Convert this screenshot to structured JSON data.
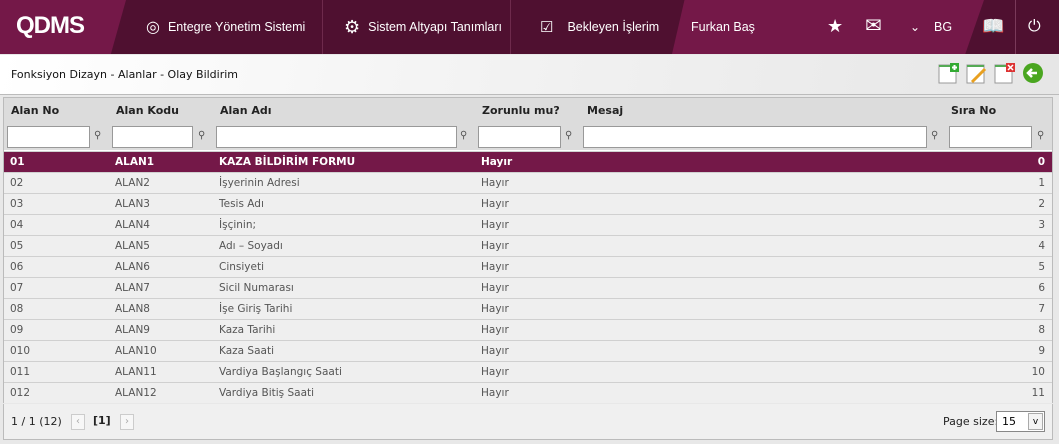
{
  "header": {
    "logo": "QDMS",
    "nav": [
      {
        "label": "Entegre Yönetim Sistemi",
        "icon": "q-logo-icon"
      },
      {
        "label": "Sistem Altyapı Tanımları",
        "icon": "gear-icon"
      },
      {
        "label": "Bekleyen İşlerim",
        "icon": "checklist-icon"
      }
    ],
    "user": "Furkan Baş",
    "lang": "BG"
  },
  "page": {
    "title": "Fonksiyon Dizayn - Alanlar - Olay Bildirim"
  },
  "toolbar": [
    "add-record-icon",
    "edit-record-icon",
    "delete-record-icon",
    "back-icon"
  ],
  "columns": [
    "Alan No",
    "Alan Kodu",
    "Alan Adı",
    "Zorunlu mu?",
    "Mesaj",
    "Sıra No"
  ],
  "rows": [
    [
      "01",
      "ALAN1",
      "KAZA BİLDİRİM FORMU",
      "Hayır",
      "",
      "0"
    ],
    [
      "02",
      "ALAN2",
      "İşyerinin Adresi",
      "Hayır",
      "",
      "1"
    ],
    [
      "03",
      "ALAN3",
      "Tesis Adı",
      "Hayır",
      "",
      "2"
    ],
    [
      "04",
      "ALAN4",
      "İşçinin;",
      "Hayır",
      "",
      "3"
    ],
    [
      "05",
      "ALAN5",
      "Adı – Soyadı",
      "Hayır",
      "",
      "4"
    ],
    [
      "06",
      "ALAN6",
      "Cinsiyeti",
      "Hayır",
      "",
      "5"
    ],
    [
      "07",
      "ALAN7",
      "Sicil Numarası",
      "Hayır",
      "",
      "6"
    ],
    [
      "08",
      "ALAN8",
      "İşe Giriş Tarihi",
      "Hayır",
      "",
      "7"
    ],
    [
      "09",
      "ALAN9",
      "Kaza Tarihi",
      "Hayır",
      "",
      "8"
    ],
    [
      "010",
      "ALAN10",
      "Kaza Saati",
      "Hayır",
      "",
      "9"
    ],
    [
      "011",
      "ALAN11",
      "Vardiya Başlangıç Saati",
      "Hayır",
      "",
      "10"
    ],
    [
      "012",
      "ALAN12",
      "Vardiya Bitiş Saati",
      "Hayır",
      "",
      "11"
    ]
  ],
  "pager": {
    "summary": "1 / 1 (12)",
    "current": "[1]",
    "page_size_label": "Page size:",
    "page_size": "15"
  },
  "colors": {
    "maroon": "#741848",
    "dark": "#4f1030"
  }
}
